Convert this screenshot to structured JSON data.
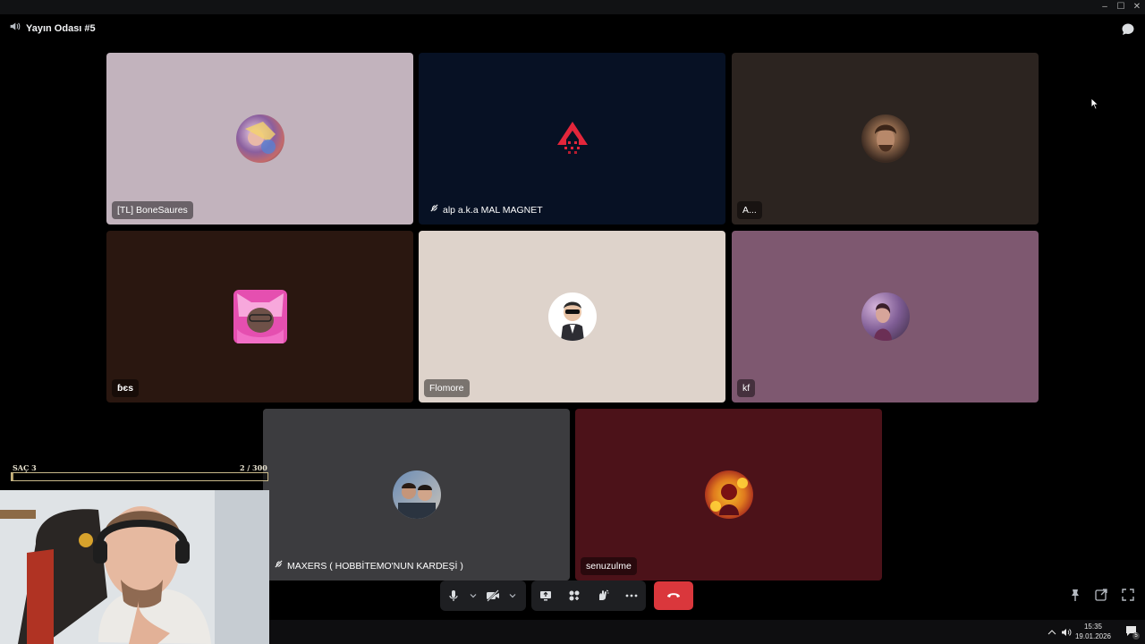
{
  "window": {
    "minimize": "–",
    "maximize": "☐",
    "close": "✕"
  },
  "room": {
    "title": "Yayın Odası #5"
  },
  "participants": [
    {
      "name": "[TL] BoneSaures",
      "bg": "#c2b3bd",
      "avatar": "anime-avatar"
    },
    {
      "name": "alp a.k.a MAL MAGNET",
      "bg": "#071124",
      "avatar": "red-arrow-logo",
      "muted_icon": true
    },
    {
      "name": "A...",
      "bg": "#2c2420",
      "avatar": "man-avatar"
    },
    {
      "name": "ɓєѕ",
      "bg": "#2a1710",
      "avatar": "cat-ear-avatar"
    },
    {
      "name": "Flomore",
      "bg": "#ded3cb",
      "avatar": "bitmoji-avatar"
    },
    {
      "name": "kf",
      "bg": "#7e5870",
      "avatar": "girl-avatar"
    },
    {
      "name": "MAXERS ( HOBBİTEMO'NUN KARDEŞİ )",
      "bg": "#3c3c3f",
      "avatar": "couple-avatar",
      "muted_icon": true
    },
    {
      "name": "senuzulme",
      "bg": "#4c1219",
      "avatar": "fire-avatar"
    }
  ],
  "xp_bar": {
    "label": "SAÇ 3",
    "progress_text": "2 / 300",
    "progress": 0.0067
  },
  "taskbar": {
    "time": "15:35",
    "date": "19.01.2026",
    "notifications": "5"
  },
  "colors": {
    "hangup": "#da373c",
    "control_bg": "#1e1f22",
    "tag_bg": "rgba(0,0,0,0.45)"
  }
}
